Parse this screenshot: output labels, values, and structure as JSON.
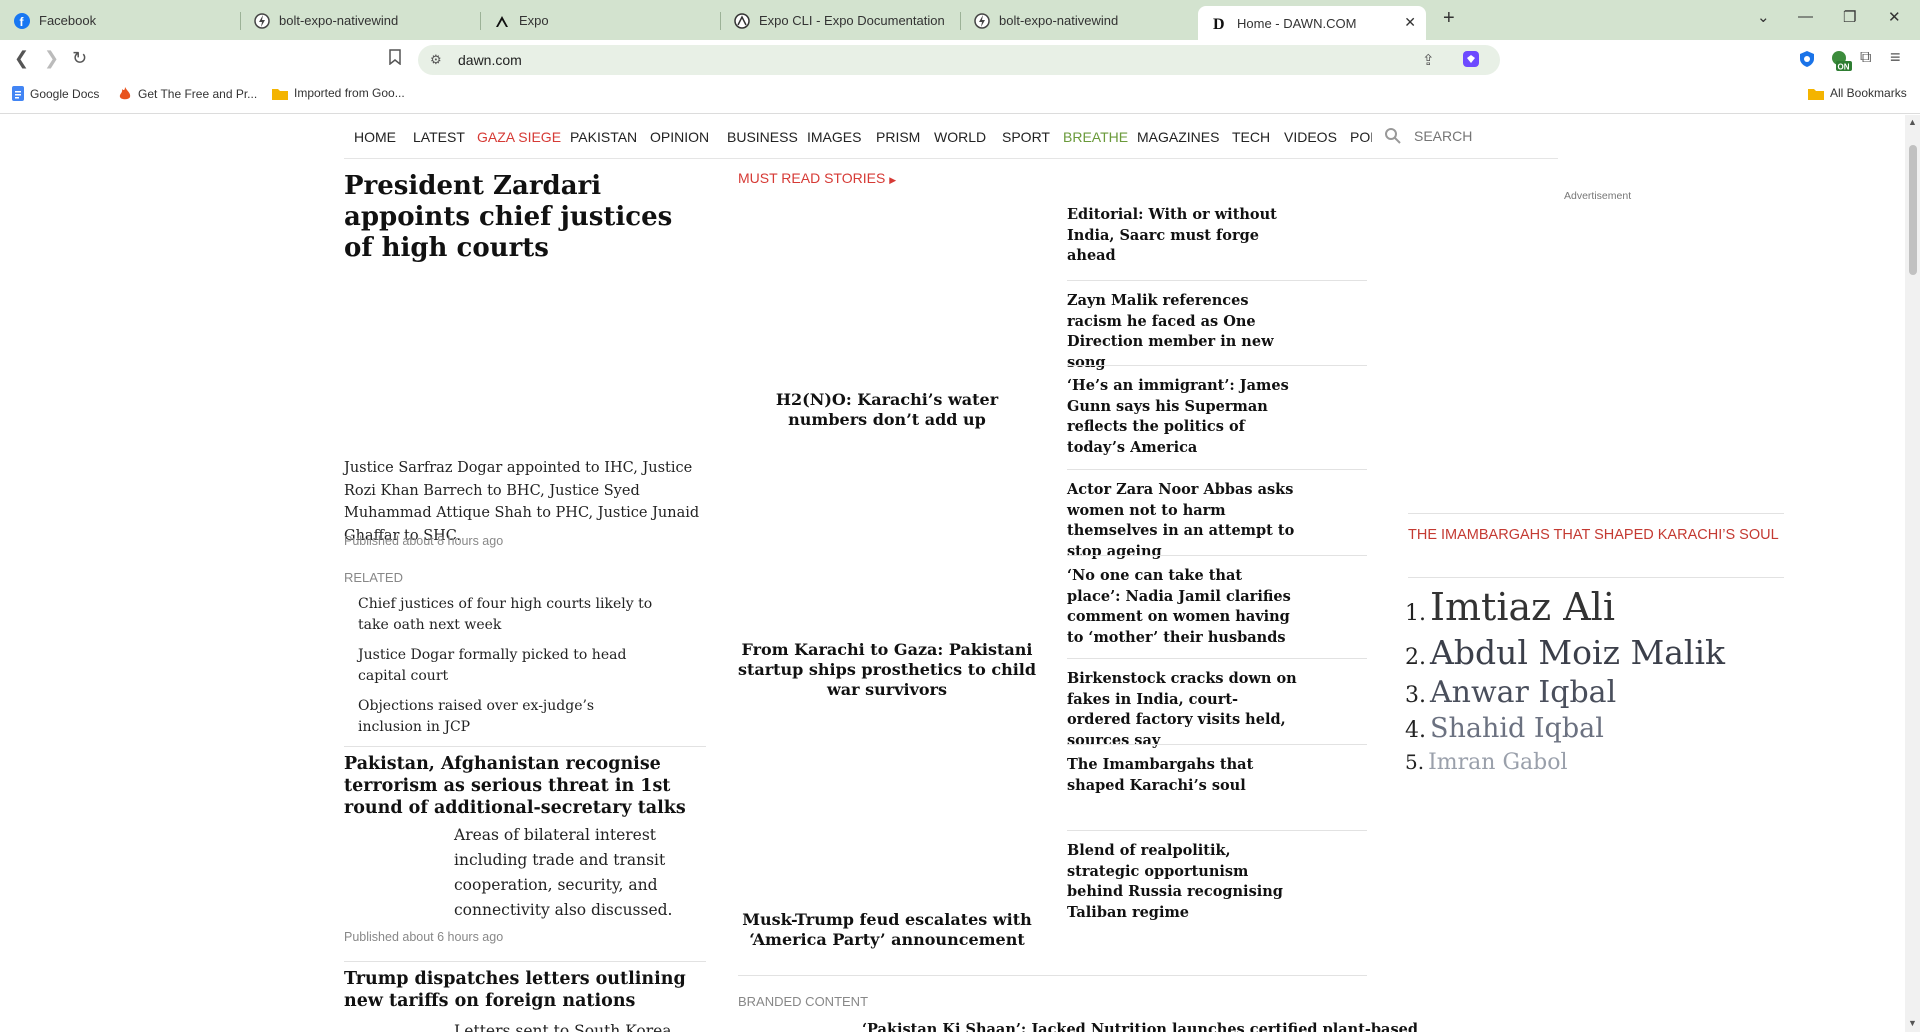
{
  "browser": {
    "tabs": [
      {
        "title": "Facebook",
        "icon": "facebook-icon"
      },
      {
        "title": "bolt-expo-nativewind",
        "icon": "bolt-icon"
      },
      {
        "title": "Expo",
        "icon": "expo-icon"
      },
      {
        "title": "Expo CLI - Expo Documentation",
        "icon": "expo-docs-icon"
      },
      {
        "title": "bolt-expo-nativewind",
        "icon": "bolt-icon"
      },
      {
        "title": "Home - DAWN.COM",
        "icon": "dawn-icon",
        "active": true
      }
    ],
    "url": "dawn.com",
    "bookmarks": [
      {
        "label": "Google Docs",
        "icon": "docs-icon"
      },
      {
        "label": "Get The Free and Pr...",
        "icon": "fire-icon"
      },
      {
        "label": "Imported from Goo...",
        "icon": "folder-icon"
      }
    ],
    "all_bookmarks": "All Bookmarks",
    "extension_badge": "ON"
  },
  "nav": {
    "items": [
      {
        "label": "HOME",
        "style": "normal"
      },
      {
        "label": "LATEST",
        "style": "normal"
      },
      {
        "label": "GAZA SIEGE",
        "style": "red"
      },
      {
        "label": "PAKISTAN",
        "style": "normal"
      },
      {
        "label": "OPINION",
        "style": "normal"
      },
      {
        "label": "BUSINESS",
        "style": "normal"
      },
      {
        "label": "IMAGES",
        "style": "normal"
      },
      {
        "label": "PRISM",
        "style": "normal"
      },
      {
        "label": "WORLD",
        "style": "normal"
      },
      {
        "label": "SPORT",
        "style": "normal"
      },
      {
        "label": "BREATHE",
        "style": "green"
      },
      {
        "label": "MAGAZINES",
        "style": "normal"
      },
      {
        "label": "TECH",
        "style": "normal"
      },
      {
        "label": "VIDEOS",
        "style": "normal"
      }
    ],
    "clipped": "POP",
    "search_placeholder": "SEARCH"
  },
  "lead": {
    "title": "President Zardari appoints chief justices of high courts",
    "excerpt": "Justice Sarfraz Dogar appointed to IHC, Justice Rozi Khan Barrech to BHC, Justice Syed Muhammad Attique Shah to PHC, Justice Junaid Ghaffar to SHC.",
    "published": "Published about 8 hours ago",
    "related_heading": "RELATED",
    "related": [
      "Chief justices of four high courts likely to take oath next week",
      "Justice Dogar formally picked to head capital court",
      "Objections raised over ex-judge’s inclusion in JCP"
    ]
  },
  "stories": [
    {
      "title": "Pakistan, Afghanistan recognise terrorism as serious threat in 1st round of additional-secretary talks",
      "excerpt": "Areas of bilateral interest including trade and transit cooperation, security, and connectivity also discussed.",
      "published": "Published about 6 hours ago"
    },
    {
      "title": "Trump dispatches letters outlining new tariffs on foreign nations",
      "excerpt": "Letters sent to South Korea"
    }
  ],
  "must_read": {
    "heading": "MUST READ STORIES",
    "center": [
      "H2(N)O: Karachi’s water numbers don’t add up",
      "From Karachi to Gaza: Pakistani startup ships prosthetics to child war survivors",
      "Musk-Trump feud escalates with ‘America Party’ announcement"
    ],
    "right": [
      "Editorial: With or without India, Saarc must forge ahead",
      "Zayn Malik references racism he faced as One Direction member in new song",
      "‘He’s an immigrant’: James Gunn says his Superman reflects the politics of today’s America",
      "Actor Zara Noor Abbas asks women not to harm themselves in an attempt to stop ageing",
      "‘No one can take that place’: Nadia Jamil clarifies comment on women having to ‘mother’ their husbands",
      "Birkenstock cracks down on fakes in India, court-ordered factory visits held, sources say",
      "The Imambargahs that shaped Karachi’s soul",
      "Blend of realpolitik, strategic opportunism behind Russia recognising Taliban regime"
    ]
  },
  "branded": {
    "heading": "BRANDED CONTENT",
    "story": "‘Pakistan Ki Shaan’: Jacked Nutrition launches certified plant-based"
  },
  "sidebar": {
    "ad_label": "Advertisement",
    "poll_title": "THE IMAMBARGAHS THAT SHAPED KARACHI’S SOUL",
    "ranked": [
      {
        "num": "1.",
        "name": "Imtiaz Ali",
        "color": "#333333"
      },
      {
        "num": "2.",
        "name": "Abdul Moiz Malik",
        "color": "#3b3f4a"
      },
      {
        "num": "3.",
        "name": "Anwar Iqbal",
        "color": "#4a4f5c"
      },
      {
        "num": "4.",
        "name": "Shahid Iqbal",
        "color": "#6b7180"
      },
      {
        "num": "5.",
        "name": "Imran Gabol",
        "color": "#9aa0ab"
      }
    ]
  },
  "colors": {
    "tabbar": "#d3e3cf",
    "accent_red": "#d63a35",
    "breathe_green": "#6a9a3a"
  }
}
